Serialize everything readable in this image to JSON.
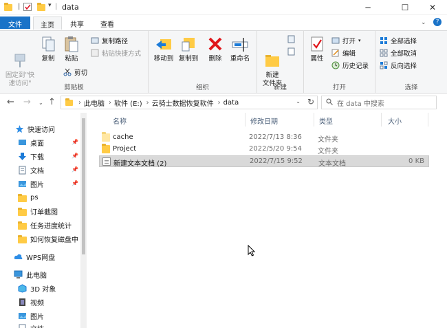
{
  "window": {
    "title": "data",
    "controls": {
      "minimize": "─",
      "maximize": "☐",
      "close": "✕"
    }
  },
  "ribbon_tabs": [
    "文件",
    "主页",
    "共享",
    "查看"
  ],
  "ribbon": {
    "clipboard": {
      "label": "剪贴板",
      "pin_quick_access": "固定到\"快\n速访问\"",
      "copy": "复制",
      "paste": "粘贴",
      "copy_path": "复制路径",
      "paste_shortcut": "粘贴快捷方式",
      "cut": "剪切"
    },
    "organize": {
      "label": "组织",
      "move_to": "移动到",
      "copy_to": "复制到",
      "delete": "删除",
      "rename": "重命名"
    },
    "new": {
      "label": "新建",
      "new_folder": "新建\n文件夹"
    },
    "open": {
      "label": "打开",
      "properties": "属性",
      "open": "打开",
      "edit": "编辑",
      "history": "历史记录"
    },
    "select": {
      "label": "选择",
      "select_all": "全部选择",
      "select_none": "全部取消",
      "invert": "反向选择"
    }
  },
  "address": {
    "crumbs": [
      "此电脑",
      "软件 (E:)",
      "云骑士数据恢复软件",
      "data"
    ],
    "search_placeholder": "在 data 中搜索"
  },
  "nav_pane": {
    "quick_access": "快速访问",
    "items": [
      "桌面",
      "下载",
      "文档",
      "图片",
      "ps",
      "订单截图",
      "任务进度统计",
      "如何恢复磁盘中"
    ],
    "wps": "WPS网盘",
    "this_pc": "此电脑",
    "pc_items": [
      "3D 对象",
      "视频",
      "图片",
      "文档"
    ]
  },
  "columns": {
    "name": "名称",
    "date": "修改日期",
    "type": "类型",
    "size": "大小"
  },
  "files": [
    {
      "name": "cache",
      "date": "2022/7/13 8:36",
      "type": "文件夹",
      "size": ""
    },
    {
      "name": "Project",
      "date": "2022/5/20 9:54",
      "type": "文件夹",
      "size": ""
    },
    {
      "name": "新建文本文档 (2)",
      "date": "2022/7/15 9:52",
      "type": "文本文档",
      "size": "0 KB"
    }
  ]
}
